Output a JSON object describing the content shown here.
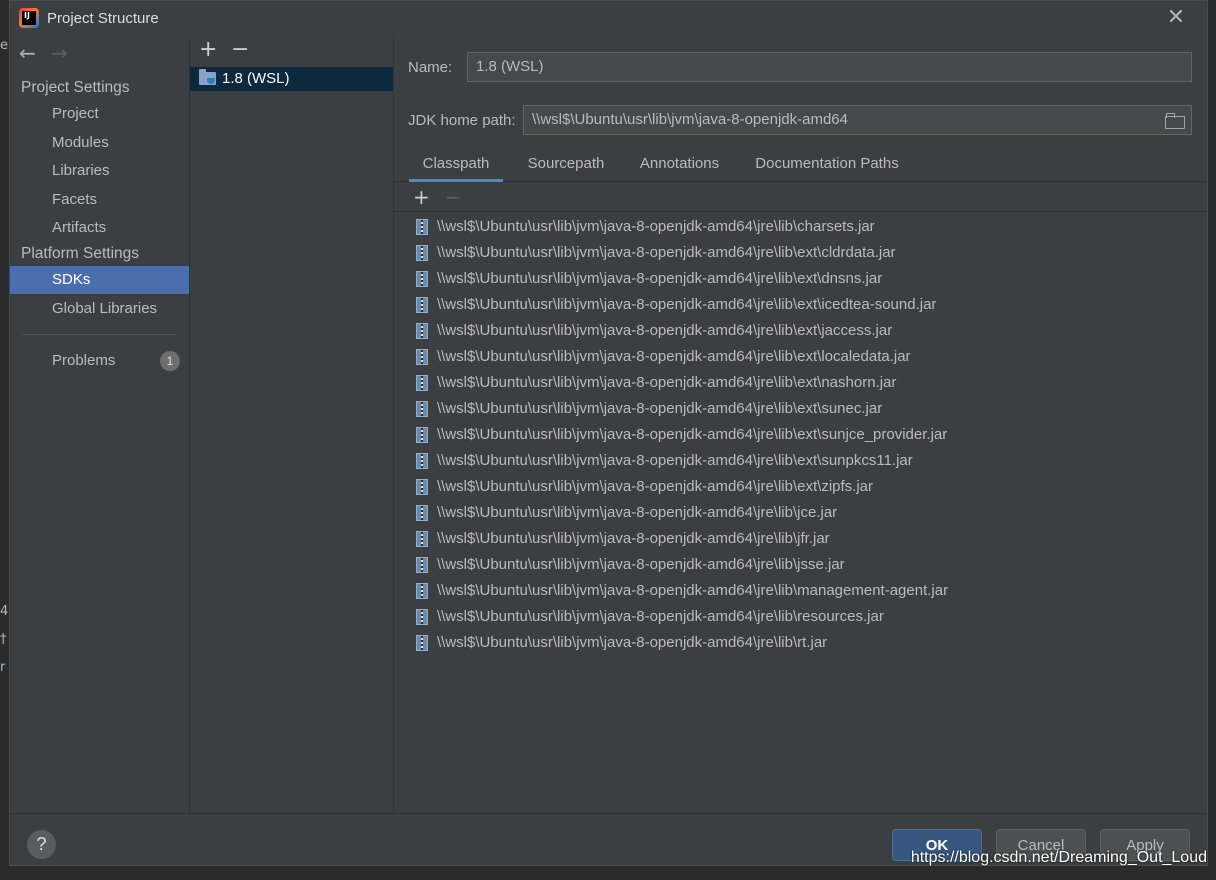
{
  "window": {
    "title": "Project Structure",
    "app_icon_text": "IJ"
  },
  "background": {
    "chars": [
      "e",
      "4",
      "†",
      "r"
    ]
  },
  "nav": {
    "back_icon": "←",
    "forward_icon": "→",
    "project_settings_header": "Project Settings",
    "platform_settings_header": "Platform Settings",
    "items": [
      {
        "label": "Project"
      },
      {
        "label": "Modules"
      },
      {
        "label": "Libraries"
      },
      {
        "label": "Facets"
      },
      {
        "label": "Artifacts"
      },
      {
        "label": "SDKs"
      },
      {
        "label": "Global Libraries"
      },
      {
        "label": "Problems",
        "badge": "1"
      }
    ]
  },
  "sdk_list": {
    "add_icon": "+",
    "remove_icon": "−",
    "items": [
      {
        "label": "1.8 (WSL)"
      }
    ]
  },
  "detail": {
    "name_label": "Name:",
    "name_value": "1.8 (WSL)",
    "home_label": "JDK home path:",
    "home_value": "\\\\wsl$\\Ubuntu\\usr\\lib\\jvm\\java-8-openjdk-amd64",
    "tabs": [
      {
        "label": "Classpath",
        "active": true
      },
      {
        "label": "Sourcepath"
      },
      {
        "label": "Annotations"
      },
      {
        "label": "Documentation Paths"
      }
    ],
    "add_icon": "+",
    "remove_icon": "−",
    "jars": [
      "\\\\wsl$\\Ubuntu\\usr\\lib\\jvm\\java-8-openjdk-amd64\\jre\\lib\\charsets.jar",
      "\\\\wsl$\\Ubuntu\\usr\\lib\\jvm\\java-8-openjdk-amd64\\jre\\lib\\ext\\cldrdata.jar",
      "\\\\wsl$\\Ubuntu\\usr\\lib\\jvm\\java-8-openjdk-amd64\\jre\\lib\\ext\\dnsns.jar",
      "\\\\wsl$\\Ubuntu\\usr\\lib\\jvm\\java-8-openjdk-amd64\\jre\\lib\\ext\\icedtea-sound.jar",
      "\\\\wsl$\\Ubuntu\\usr\\lib\\jvm\\java-8-openjdk-amd64\\jre\\lib\\ext\\jaccess.jar",
      "\\\\wsl$\\Ubuntu\\usr\\lib\\jvm\\java-8-openjdk-amd64\\jre\\lib\\ext\\localedata.jar",
      "\\\\wsl$\\Ubuntu\\usr\\lib\\jvm\\java-8-openjdk-amd64\\jre\\lib\\ext\\nashorn.jar",
      "\\\\wsl$\\Ubuntu\\usr\\lib\\jvm\\java-8-openjdk-amd64\\jre\\lib\\ext\\sunec.jar",
      "\\\\wsl$\\Ubuntu\\usr\\lib\\jvm\\java-8-openjdk-amd64\\jre\\lib\\ext\\sunjce_provider.jar",
      "\\\\wsl$\\Ubuntu\\usr\\lib\\jvm\\java-8-openjdk-amd64\\jre\\lib\\ext\\sunpkcs11.jar",
      "\\\\wsl$\\Ubuntu\\usr\\lib\\jvm\\java-8-openjdk-amd64\\jre\\lib\\ext\\zipfs.jar",
      "\\\\wsl$\\Ubuntu\\usr\\lib\\jvm\\java-8-openjdk-amd64\\jre\\lib\\jce.jar",
      "\\\\wsl$\\Ubuntu\\usr\\lib\\jvm\\java-8-openjdk-amd64\\jre\\lib\\jfr.jar",
      "\\\\wsl$\\Ubuntu\\usr\\lib\\jvm\\java-8-openjdk-amd64\\jre\\lib\\jsse.jar",
      "\\\\wsl$\\Ubuntu\\usr\\lib\\jvm\\java-8-openjdk-amd64\\jre\\lib\\management-agent.jar",
      "\\\\wsl$\\Ubuntu\\usr\\lib\\jvm\\java-8-openjdk-amd64\\jre\\lib\\resources.jar",
      "\\\\wsl$\\Ubuntu\\usr\\lib\\jvm\\java-8-openjdk-amd64\\jre\\lib\\rt.jar"
    ]
  },
  "footer": {
    "help_label": "?",
    "ok_label": "OK",
    "cancel_label": "Cancel",
    "apply_label": "Apply",
    "watermark": "https://blog.csdn.net/Dreaming_Out_Loud"
  },
  "colors": {
    "dialog_bg": "#3c3f41",
    "selection": "#4b6eaf",
    "ok_button": "#365880",
    "tab_underline": "#4a88c7"
  }
}
